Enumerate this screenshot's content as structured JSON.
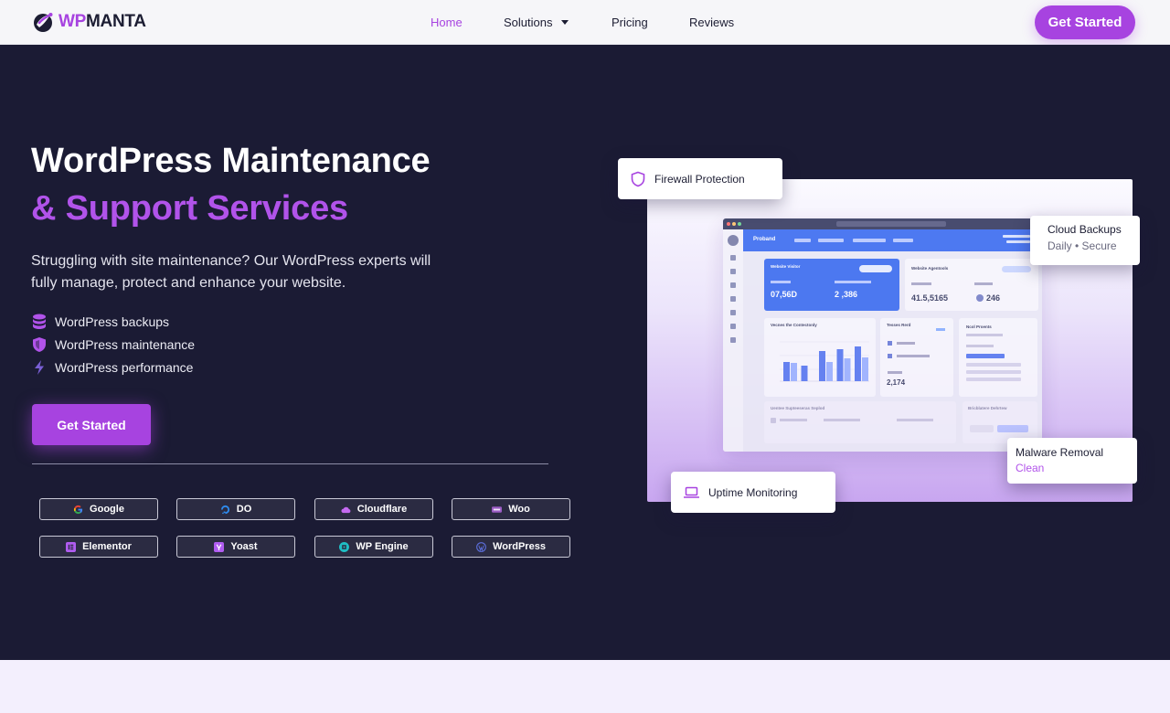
{
  "brand": {
    "wp": "WP",
    "manta": "MANTA",
    "accent": "#a743e0",
    "dark": "#1b1b34"
  },
  "nav": {
    "links": [
      {
        "label": "Home",
        "active": true
      },
      {
        "label": "Solutions",
        "dropdown": true
      },
      {
        "label": "Pricing"
      },
      {
        "label": "Reviews"
      }
    ],
    "cta": "Get Started"
  },
  "hero": {
    "title_line1": "WordPress Maintenance",
    "title_line2": "& Support Services",
    "subtitle": "Struggling with site maintenance? Our WordPress experts will fully manage, protect and enhance your website.",
    "features": [
      {
        "icon": "database-icon",
        "label": "WordPress backups"
      },
      {
        "icon": "shield-icon",
        "label": "WordPress maintenance"
      },
      {
        "icon": "lightning-icon",
        "label": "WordPress performance"
      }
    ],
    "cta": "Get Started",
    "partners": [
      {
        "label": "Google",
        "icon": "google-icon"
      },
      {
        "label": "DO",
        "icon": "digitalocean-icon"
      },
      {
        "label": "Cloudflare",
        "icon": "cloud-icon"
      },
      {
        "label": "Woo",
        "icon": "woo-icon"
      },
      {
        "label": "Elementor",
        "icon": "elementor-icon"
      },
      {
        "label": "Yoast",
        "icon": "yoast-icon"
      },
      {
        "label": "WP Engine",
        "icon": "wpengine-icon"
      },
      {
        "label": "WordPress",
        "icon": "wordpress-icon"
      }
    ]
  },
  "floating_cards": {
    "firewall": "Firewall Protection",
    "backups_title": "Cloud Backups",
    "backups_sub": "Daily • Secure",
    "malware_title": "Malware Removal",
    "malware_sub": "Clean",
    "uptime": "Uptime Monitoring"
  },
  "dashboard": {
    "brand": "Proband",
    "card1_title": "Website Visitor",
    "card1_v1": "07,56D",
    "card1_v2": "2 ,386",
    "card2_title": "Website Agentools",
    "card2_v1": "41.5,5165",
    "card2_v2": "246",
    "chart_title": "Vecnes the Contectonly",
    "mid_title": "Tesses Rerd",
    "mid_value": "2,174",
    "right_title": "Ncol Proents",
    "bottom_left": "Uentee Supteeseras Seplod",
    "bottom_right": "Bricblatere Dehrtew",
    "bars": [
      [
        0.42,
        0.4
      ],
      [
        0.34,
        0.0
      ],
      [
        0.66,
        0.42
      ],
      [
        0.7,
        0.5
      ],
      [
        0.76,
        0.52
      ]
    ]
  }
}
